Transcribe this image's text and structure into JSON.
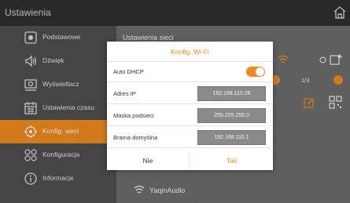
{
  "header": {
    "title": "Ustawienia",
    "home_icon": "home-icon"
  },
  "sidebar": {
    "items": [
      {
        "label": "Podstawowe",
        "icon": "basic-settings-icon"
      },
      {
        "label": "Dźwięk",
        "icon": "speaker-icon"
      },
      {
        "label": "Wyświetlacz",
        "icon": "display-icon"
      },
      {
        "label": "Ustawienia czasu",
        "icon": "calendar-icon"
      },
      {
        "label": "Konfig. sieci",
        "icon": "network-icon",
        "active": true
      },
      {
        "label": "Konfiguracja",
        "icon": "configuration-icon"
      },
      {
        "label": "Informacje",
        "icon": "info-icon"
      }
    ]
  },
  "background": {
    "section_title": "Ustawienia sieci",
    "page": "1/3",
    "wifi_list": [
      "YaqinAudio"
    ]
  },
  "dialog": {
    "title": "Konfig. Wi-Fi",
    "auto_dhcp_label": "Auto DHCP",
    "auto_dhcp_on": true,
    "ip_label": "Adres IP",
    "ip_value": "192.168.110.26",
    "mask_label": "Maska podsieci",
    "mask_value": "255.255.255.0",
    "gateway_label": "Brama domyślna",
    "gateway_value": "192.168.110.1",
    "no_label": "Nie",
    "yes_label": "Tak"
  },
  "colors": {
    "accent": "#ef8a1f",
    "sidebar": "#4f4f4f",
    "topbar": "#2f2f2f"
  }
}
